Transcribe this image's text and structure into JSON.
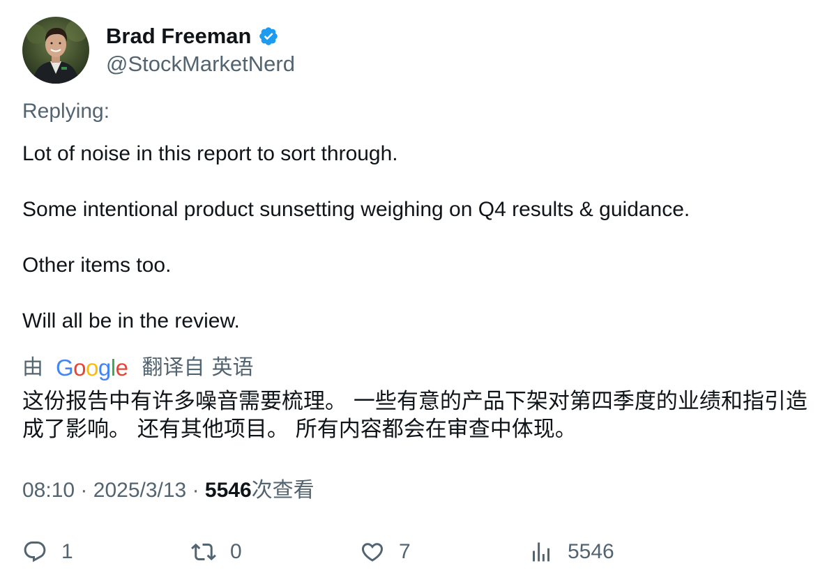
{
  "author": {
    "display_name": "Brad Freeman",
    "handle": "@StockMarketNerd",
    "verified": true
  },
  "replying_label": "Replying:",
  "tweet": {
    "lines": [
      "Lot of noise in this report to sort through.",
      "Some intentional product sunsetting weighing on Q4 results & guidance.",
      "Other items too.",
      "Will all be in the review."
    ]
  },
  "translation": {
    "by_label": "由",
    "provider": "Google",
    "translated_from_label": "翻译自",
    "source_language": "英语",
    "text": "这份报告中有许多噪音需要梳理。 一些有意的产品下架对第四季度的业绩和指引造成了影响。 还有其他项目。 所有内容都会在审查中体现。"
  },
  "meta": {
    "time": "08:10",
    "date": "2025/3/13",
    "separator": "·",
    "views_count": "5546",
    "views_label": "次查看"
  },
  "actions": {
    "reply_count": "1",
    "retweet_count": "0",
    "like_count": "7",
    "views_count": "5546"
  },
  "colors": {
    "text_primary": "#0f1419",
    "text_secondary": "#536471",
    "verified_blue": "#1d9bf0",
    "google_blue": "#4285F4",
    "google_red": "#EA4335",
    "google_yellow": "#FBBC05",
    "google_green": "#34A853"
  },
  "icons": {
    "verified": "verified-badge-icon",
    "reply": "speech-bubble-icon",
    "retweet": "retweet-arrows-icon",
    "like": "heart-icon",
    "views": "bar-chart-icon"
  }
}
